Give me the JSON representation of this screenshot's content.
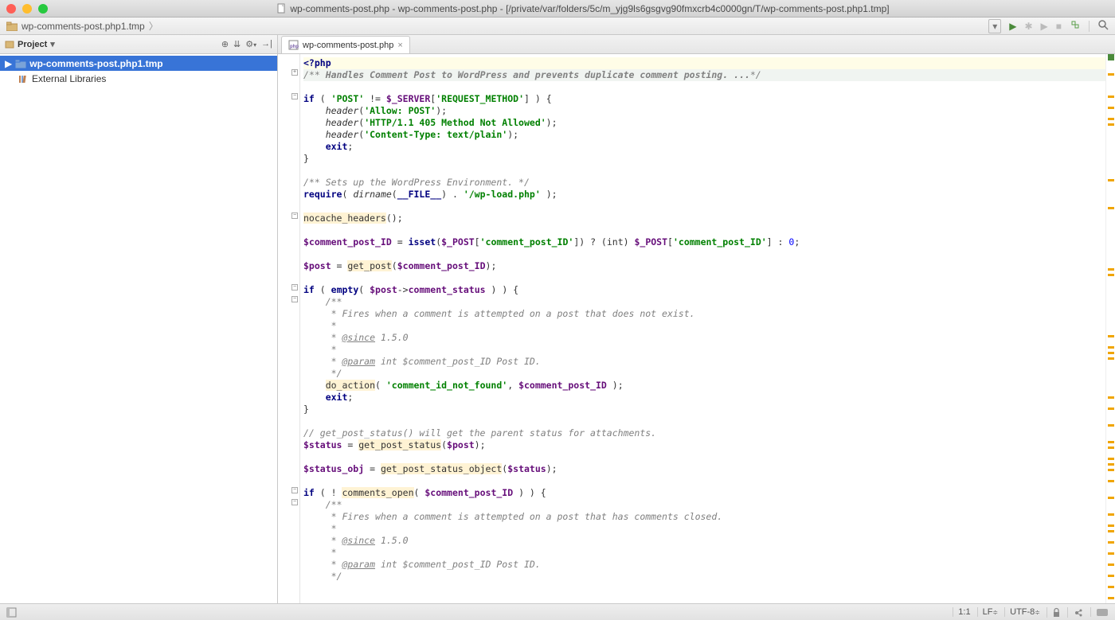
{
  "window_title": "wp-comments-post.php - wp-comments-post.php - [/private/var/folders/5c/m_yjg9ls6gsgvg90fmxcrb4c0000gn/T/wp-comments-post.php1.tmp]",
  "breadcrumb": {
    "item": "wp-comments-post.php1.tmp"
  },
  "project_header": "Project",
  "tree": {
    "root": "wp-comments-post.php1.tmp",
    "ext": "External Libraries"
  },
  "editor_tab": "wp-comments-post.php",
  "status": {
    "pos": "1:1",
    "eol": "LF",
    "enc": "UTF-8"
  },
  "code_lines": [
    {
      "cls": "hl1",
      "h": "<span class='kw'>&lt;?php</span>"
    },
    {
      "cls": "hl2",
      "h": "<span class='cm'>/** </span><span class='cm' style='font-weight:bold'>Handles Comment Post to WordPress and prevents duplicate comment posting. ...</span><span class='cm'>*/</span>"
    },
    {
      "cls": "",
      "h": ""
    },
    {
      "cls": "",
      "h": "<span class='kw'>if</span> ( <span class='str'>'POST'</span> != <span class='var'>$_SERVER</span>[<span class='str'>'REQUEST_METHOD'</span>] ) {"
    },
    {
      "cls": "",
      "h": "    <span style='font-style:italic'>header</span>(<span class='str'>'Allow: POST'</span>);"
    },
    {
      "cls": "",
      "h": "    <span style='font-style:italic'>header</span>(<span class='str'>'HTTP/1.1 405 Method Not Allowed'</span>);"
    },
    {
      "cls": "",
      "h": "    <span style='font-style:italic'>header</span>(<span class='str'>'Content-Type: text/plain'</span>);"
    },
    {
      "cls": "",
      "h": "    <span class='kw'>exit</span>;"
    },
    {
      "cls": "",
      "h": "}"
    },
    {
      "cls": "",
      "h": ""
    },
    {
      "cls": "",
      "h": "<span class='cm'>/** Sets up the WordPress Environment. */</span>"
    },
    {
      "cls": "",
      "h": "<span class='kw'>require</span>( <span style='font-style:italic'>dirname</span>(<span class='kw'>__FILE__</span>) . <span class='str'>'/wp-load.php'</span> );"
    },
    {
      "cls": "",
      "h": ""
    },
    {
      "cls": "",
      "h": "<span class='fn'>nocache_headers</span>();"
    },
    {
      "cls": "",
      "h": ""
    },
    {
      "cls": "",
      "h": "<span class='var'>$comment_post_ID</span> = <span class='kw'>isset</span>(<span class='var'>$_POST</span>[<span class='str'>'comment_post_ID'</span>]) ? (int) <span class='var'>$_POST</span>[<span class='str'>'comment_post_ID'</span>] : <span class='num'>0</span>;"
    },
    {
      "cls": "",
      "h": ""
    },
    {
      "cls": "",
      "h": "<span class='var'>$post</span> = <span class='fn'>get_post</span>(<span class='var'>$comment_post_ID</span>);"
    },
    {
      "cls": "",
      "h": ""
    },
    {
      "cls": "",
      "h": "<span class='kw'>if</span> ( <span class='kw'>empty</span>( <span class='var'>$post</span>-&gt;<span class='fld'>comment_status</span> ) ) {"
    },
    {
      "cls": "",
      "h": "    <span class='cm'>/**</span>"
    },
    {
      "cls": "",
      "h": "<span class='cm'>     * Fires when a comment is attempted on a post that does not exist.</span>"
    },
    {
      "cls": "",
      "h": "<span class='cm'>     *</span>"
    },
    {
      "cls": "",
      "h": "<span class='cm'>     * <span class='u'>@since</span> 1.5.0</span>"
    },
    {
      "cls": "",
      "h": "<span class='cm'>     *</span>"
    },
    {
      "cls": "",
      "h": "<span class='cm'>     * <span class='u'>@param</span> int $comment_post_ID Post ID.</span>"
    },
    {
      "cls": "",
      "h": "<span class='cm'>     */</span>"
    },
    {
      "cls": "",
      "h": "    <span class='fn'>do_action</span>( <span class='str'>'comment_id_not_found'</span>, <span class='var'>$comment_post_ID</span> );"
    },
    {
      "cls": "",
      "h": "    <span class='kw'>exit</span>;"
    },
    {
      "cls": "",
      "h": "}"
    },
    {
      "cls": "",
      "h": ""
    },
    {
      "cls": "",
      "h": "<span class='cm'>// get_post_status() will get the parent status for attachments.</span>"
    },
    {
      "cls": "",
      "h": "<span class='var'>$status</span> = <span class='fn'>get_post_status</span>(<span class='var'>$post</span>);"
    },
    {
      "cls": "",
      "h": ""
    },
    {
      "cls": "",
      "h": "<span class='var'>$status_obj</span> = <span class='fn'>get_post_status_object</span>(<span class='var'>$status</span>);"
    },
    {
      "cls": "",
      "h": ""
    },
    {
      "cls": "",
      "h": "<span class='kw'>if</span> ( ! <span class='fn'>comments_open</span>( <span class='var'>$comment_post_ID</span> ) ) {"
    },
    {
      "cls": "",
      "h": "    <span class='cm'>/**</span>"
    },
    {
      "cls": "",
      "h": "<span class='cm'>     * Fires when a comment is attempted on a post that has comments closed.</span>"
    },
    {
      "cls": "",
      "h": "<span class='cm'>     *</span>"
    },
    {
      "cls": "",
      "h": "<span class='cm'>     * <span class='u'>@since</span> 1.5.0</span>"
    },
    {
      "cls": "",
      "h": "<span class='cm'>     *</span>"
    },
    {
      "cls": "",
      "h": "<span class='cm'>     * <span class='u'>@param</span> int $comment_post_ID Post ID.</span>"
    },
    {
      "cls": "",
      "h": "<span class='cm'>     */</span>"
    }
  ],
  "fold_markers": [
    1,
    3,
    13,
    19,
    20,
    36,
    37
  ],
  "minimap_marks": [
    2,
    6,
    8,
    10,
    11,
    21,
    26,
    37,
    38,
    49,
    51,
    52,
    53,
    60,
    62,
    65,
    68,
    69,
    71,
    72,
    73,
    75,
    78,
    81,
    83,
    84,
    86,
    88,
    90,
    92,
    94,
    96
  ]
}
